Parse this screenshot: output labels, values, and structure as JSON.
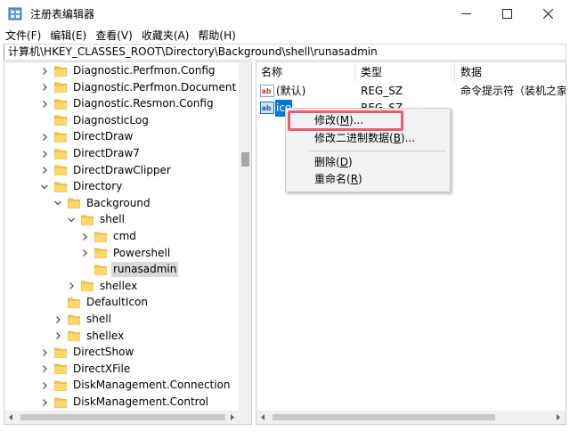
{
  "window": {
    "title": "注册表编辑器",
    "accent_color": "#0078d7",
    "highlight_color": "#ef5b6e",
    "icon": "regedit-icon"
  },
  "menubar": {
    "items": [
      "文件(F)",
      "编辑(E)",
      "查看(V)",
      "收藏夹(A)",
      "帮助(H)"
    ]
  },
  "address": {
    "path": "计算机\\HKEY_CLASSES_ROOT\\Directory\\Background\\shell\\runasadmin"
  },
  "tree": {
    "items": [
      {
        "label": "Diagnostic.Perfmon.Config",
        "depth": 0,
        "expander": "collapsed"
      },
      {
        "label": "Diagnostic.Perfmon.Document",
        "depth": 0,
        "expander": "collapsed"
      },
      {
        "label": "Diagnostic.Resmon.Config",
        "depth": 0,
        "expander": "collapsed"
      },
      {
        "label": "DiagnosticLog",
        "depth": 0,
        "expander": "none"
      },
      {
        "label": "DirectDraw",
        "depth": 0,
        "expander": "collapsed"
      },
      {
        "label": "DirectDraw7",
        "depth": 0,
        "expander": "collapsed"
      },
      {
        "label": "DirectDrawClipper",
        "depth": 0,
        "expander": "collapsed"
      },
      {
        "label": "Directory",
        "depth": 0,
        "expander": "expanded"
      },
      {
        "label": "Background",
        "depth": 1,
        "expander": "expanded"
      },
      {
        "label": "shell",
        "depth": 2,
        "expander": "expanded"
      },
      {
        "label": "cmd",
        "depth": 3,
        "expander": "collapsed"
      },
      {
        "label": "Powershell",
        "depth": 3,
        "expander": "collapsed"
      },
      {
        "label": "runasadmin",
        "depth": 3,
        "expander": "none",
        "selected": true
      },
      {
        "label": "shellex",
        "depth": 2,
        "expander": "collapsed"
      },
      {
        "label": "DefaultIcon",
        "depth": 1,
        "expander": "none"
      },
      {
        "label": "shell",
        "depth": 1,
        "expander": "collapsed"
      },
      {
        "label": "shellex",
        "depth": 1,
        "expander": "collapsed"
      },
      {
        "label": "DirectShow",
        "depth": 0,
        "expander": "collapsed"
      },
      {
        "label": "DirectXFile",
        "depth": 0,
        "expander": "collapsed"
      },
      {
        "label": "DiskManagement.Connection",
        "depth": 0,
        "expander": "collapsed"
      },
      {
        "label": "DiskManagement.Control",
        "depth": 0,
        "expander": "collapsed"
      }
    ]
  },
  "list": {
    "columns": [
      "名称",
      "类型",
      "数据"
    ],
    "rows": [
      {
        "name": "(默认)",
        "type": "REG_SZ",
        "data": "命令提示符（装机之家）",
        "icon": "string-value-icon"
      },
      {
        "name": "ico",
        "type": "REG_SZ",
        "data": "",
        "icon": "string-value-icon",
        "selected": true
      }
    ]
  },
  "context_menu": {
    "items": [
      {
        "prefix": "修改(",
        "key": "M",
        "suffix": ")..."
      },
      {
        "prefix": "修改二进制数据(",
        "key": "B",
        "suffix": ")..."
      },
      {
        "prefix": "删除(",
        "key": "D",
        "suffix": ")"
      },
      {
        "prefix": "重命名(",
        "key": "R",
        "suffix": ")"
      }
    ]
  }
}
